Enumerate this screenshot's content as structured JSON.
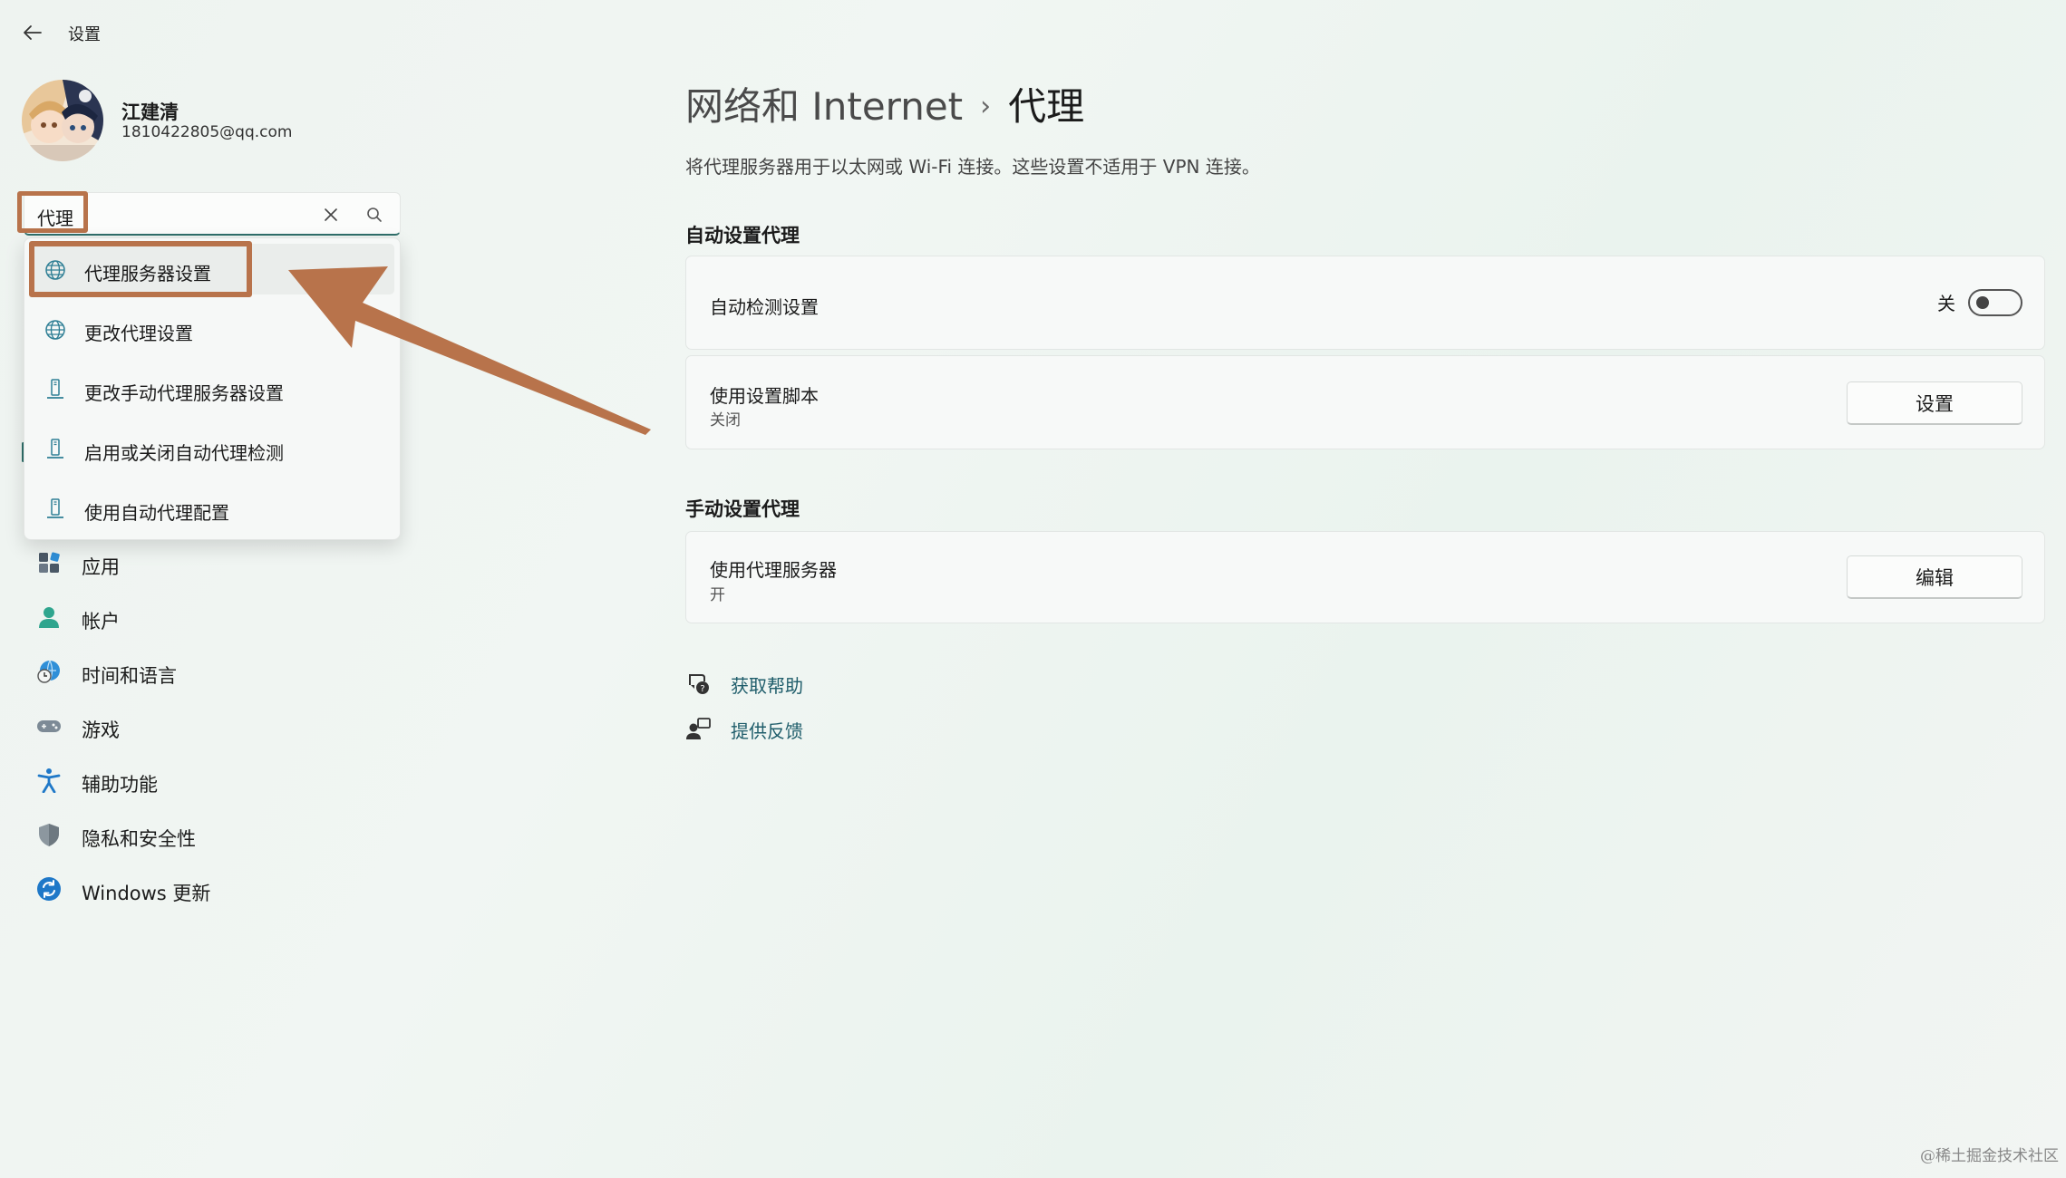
{
  "window": {
    "title": "设置"
  },
  "profile": {
    "name": "江建清",
    "email": "1810422805@qq.com"
  },
  "search": {
    "value": "代理"
  },
  "suggestions": [
    {
      "label": "代理服务器设置",
      "icon": "globe-icon"
    },
    {
      "label": "更改代理设置",
      "icon": "globe-icon"
    },
    {
      "label": "更改手动代理服务器设置",
      "icon": "pc-tower-icon"
    },
    {
      "label": "启用或关闭自动代理检测",
      "icon": "pc-tower-icon"
    },
    {
      "label": "使用自动代理配置",
      "icon": "pc-tower-icon"
    }
  ],
  "nav": [
    {
      "label": "应用",
      "icon": "apps-icon"
    },
    {
      "label": "帐户",
      "icon": "account-icon"
    },
    {
      "label": "时间和语言",
      "icon": "time-language-icon"
    },
    {
      "label": "游戏",
      "icon": "gamepad-icon"
    },
    {
      "label": "辅助功能",
      "icon": "accessibility-icon"
    },
    {
      "label": "隐私和安全性",
      "icon": "shield-icon"
    },
    {
      "label": "Windows 更新",
      "icon": "windows-update-icon"
    }
  ],
  "main": {
    "breadcrumb_parent": "网络和 Internet",
    "breadcrumb_sep": "›",
    "breadcrumb_current": "代理",
    "description": "将代理服务器用于以太网或 Wi-Fi 连接。这些设置不适用于 VPN 连接。",
    "auto_section": {
      "title": "自动设置代理",
      "detect": {
        "title": "自动检测设置",
        "state": "关",
        "enabled": false
      },
      "script": {
        "title": "使用设置脚本",
        "status": "关闭",
        "button": "设置"
      }
    },
    "manual_section": {
      "title": "手动设置代理",
      "server": {
        "title": "使用代理服务器",
        "status": "开",
        "button": "编辑"
      }
    },
    "links": {
      "help": "获取帮助",
      "feedback": "提供反馈"
    }
  },
  "watermark": "@稀土掘金技术社区",
  "colors": {
    "annotation": "#b8734b",
    "accent": "#2f6f6a",
    "link": "#1f5d6b"
  }
}
